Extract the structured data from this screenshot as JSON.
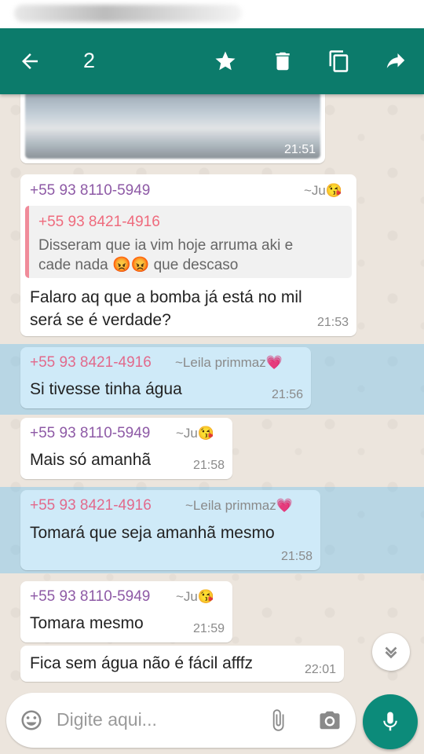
{
  "app_bar": {
    "selected_count": "2"
  },
  "messages": [
    {
      "time": "21:51"
    },
    {
      "sender": "+55 93 8110-5949",
      "push_name": "~Ju😘",
      "quote": {
        "sender": "+55 93 8421-4916",
        "line1": "Disseram que ia vim hoje arruma aki e",
        "line2": "cade nada 😡😡 que descaso"
      },
      "line1": "Falaro aq que a bomba já está no mil",
      "line2": "será se é verdade?",
      "time": "21:53"
    },
    {
      "sender": "+55 93 8421-4916",
      "push_name": "~Leila primmaz💗",
      "text": "Si tivesse tinha água",
      "time": "21:56"
    },
    {
      "sender": "+55 93 8110-5949",
      "push_name": "~Ju😘",
      "text": "Mais só amanhã",
      "time": "21:58"
    },
    {
      "sender": "+55 93 8421-4916",
      "push_name": "~Leila primmaz💗",
      "text": "Tomará que seja amanhã mesmo",
      "time": "21:58"
    },
    {
      "sender": "+55 93 8110-5949",
      "push_name": "~Ju😘",
      "text": "Tomara mesmo",
      "time": "21:59"
    },
    {
      "text": "Fica sem água não é fácil afffz",
      "time": "22:01"
    }
  ],
  "input": {
    "placeholder": "Digite aqui..."
  },
  "colors": {
    "app_bar": "#0c7b6b",
    "selection": "#cfeaf8",
    "fab": "#0c8b7a"
  }
}
